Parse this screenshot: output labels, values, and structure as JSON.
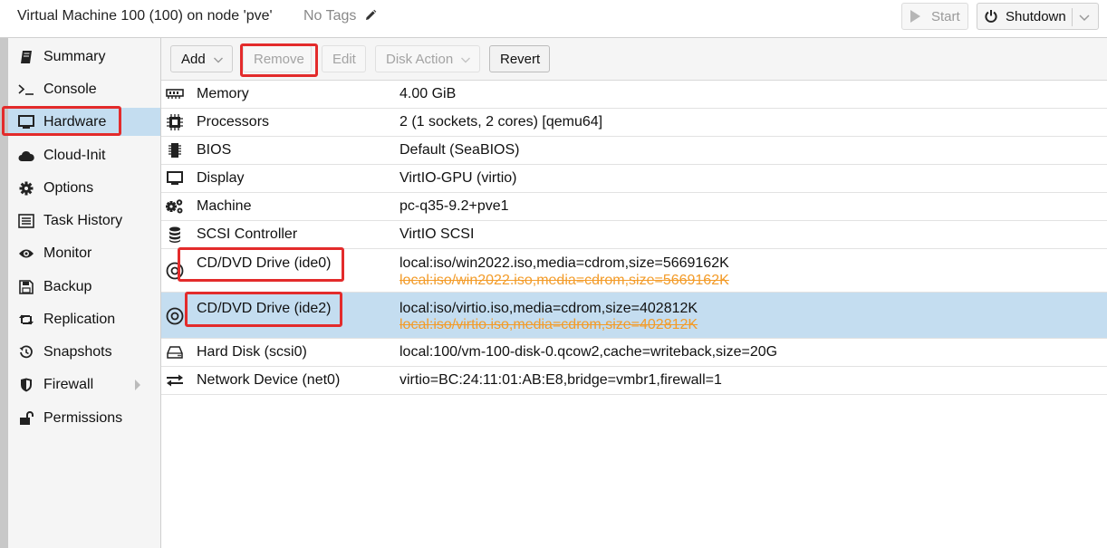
{
  "header": {
    "title": "Virtual Machine 100 (100) on node 'pve'",
    "tags": "No Tags",
    "start_label": "Start",
    "shutdown_label": "Shutdown"
  },
  "sidebar": {
    "items": [
      {
        "label": "Summary",
        "icon": "book-icon"
      },
      {
        "label": "Console",
        "icon": "terminal-icon"
      },
      {
        "label": "Hardware",
        "icon": "monitor-icon",
        "selected": true
      },
      {
        "label": "Cloud-Init",
        "icon": "cloud-icon"
      },
      {
        "label": "Options",
        "icon": "gear-icon"
      },
      {
        "label": "Task History",
        "icon": "list-icon"
      },
      {
        "label": "Monitor",
        "icon": "eye-icon"
      },
      {
        "label": "Backup",
        "icon": "floppy-icon"
      },
      {
        "label": "Replication",
        "icon": "retweet-icon"
      },
      {
        "label": "Snapshots",
        "icon": "history-icon"
      },
      {
        "label": "Firewall",
        "icon": "shield-icon",
        "has_submenu": true
      },
      {
        "label": "Permissions",
        "icon": "unlock-icon"
      }
    ]
  },
  "toolbar": {
    "add_label": "Add",
    "remove_label": "Remove",
    "edit_label": "Edit",
    "disk_action_label": "Disk Action",
    "revert_label": "Revert"
  },
  "hardware": {
    "rows": [
      {
        "name": "Memory",
        "value": "4.00 GiB",
        "icon": "memory-icon"
      },
      {
        "name": "Processors",
        "value": "2 (1 sockets, 2 cores) [qemu64]",
        "icon": "cpu-icon"
      },
      {
        "name": "BIOS",
        "value": "Default (SeaBIOS)",
        "icon": "microchip-icon"
      },
      {
        "name": "Display",
        "value": "VirtIO-GPU (virtio)",
        "icon": "display-icon"
      },
      {
        "name": "Machine",
        "value": "pc-q35-9.2+pve1",
        "icon": "cogs-icon"
      },
      {
        "name": "SCSI Controller",
        "value": "VirtIO SCSI",
        "icon": "database-icon"
      },
      {
        "name": "CD/DVD Drive (ide0)",
        "value": "local:iso/win2022.iso,media=cdrom,size=5669162K",
        "pending": "local:iso/win2022.iso,media=cdrom,size=5669162K",
        "icon": "cdrom-icon"
      },
      {
        "name": "CD/DVD Drive (ide2)",
        "value": "local:iso/virtio.iso,media=cdrom,size=402812K",
        "pending": "local:iso/virtio.iso,media=cdrom,size=402812K",
        "icon": "cdrom-icon",
        "selected": true
      },
      {
        "name": "Hard Disk (scsi0)",
        "value": "local:100/vm-100-disk-0.qcow2,cache=writeback,size=20G",
        "icon": "hdd-icon"
      },
      {
        "name": "Network Device (net0)",
        "value": "virtio=BC:24:11:01:AB:E8,bridge=vmbr1,firewall=1",
        "icon": "exchange-icon"
      }
    ]
  },
  "colors": {
    "selected_bg": "#c4ddf0",
    "pending_text": "#f39c2a",
    "highlight_box": "#e32b2b"
  }
}
